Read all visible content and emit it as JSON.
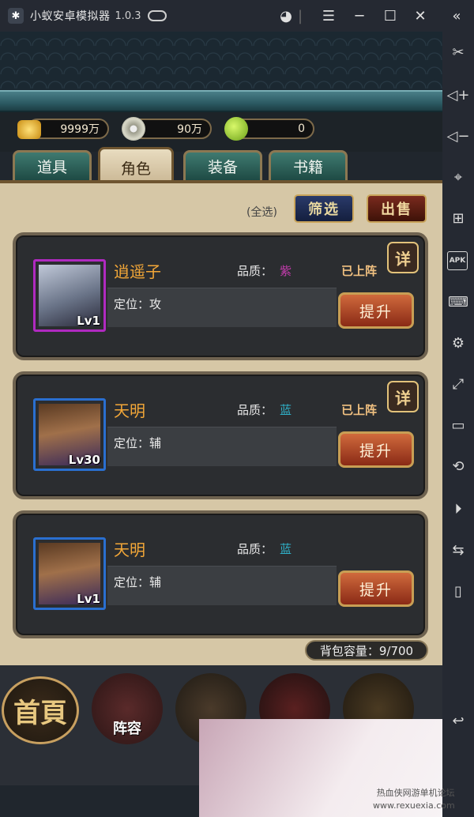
{
  "window": {
    "app_title": "小蚁安卓模拟器",
    "version": "1.0.3"
  },
  "resources": {
    "gold": "9999万",
    "coins": "90万",
    "gems": "0"
  },
  "tabs": [
    {
      "label": "道具"
    },
    {
      "label": "角色"
    },
    {
      "label": "装备"
    },
    {
      "label": "书籍"
    }
  ],
  "active_tab": "角色",
  "toolbar": {
    "select_all": "(全选)",
    "filter_label": "筛选",
    "sell_label": "出售"
  },
  "characters": [
    {
      "name": "逍遥子",
      "quality_label": "品质：",
      "quality": "紫",
      "quality_color": "#c03caa",
      "status": "已上阵",
      "role": "定位：攻",
      "level": "Lv1",
      "frame_color": "#b02ac0",
      "detail_label": "详",
      "upgrade_label": "提升"
    },
    {
      "name": "天明",
      "quality_label": "品质：",
      "quality": "蓝",
      "quality_color": "#2fb0c8",
      "status": "已上阵",
      "role": "定位：辅",
      "level": "Lv30",
      "frame_color": "#2a6fd0",
      "detail_label": "详",
      "upgrade_label": "提升"
    },
    {
      "name": "天明",
      "quality_label": "品质：",
      "quality": "蓝",
      "quality_color": "#2fb0c8",
      "status": "",
      "role": "定位：辅",
      "level": "Lv1",
      "frame_color": "#2a6fd0",
      "detail_label": "",
      "upgrade_label": "提升"
    }
  ],
  "capacity": "背包容量：9/700",
  "bottom_nav": {
    "home": "首頁",
    "lineup": "阵容"
  },
  "watermark": {
    "line1": "热血侠网游单机论坛",
    "line2": "www.rexuexia.com"
  },
  "colors": {
    "accent": "#f3a738",
    "panel": "#d6c7a6"
  }
}
